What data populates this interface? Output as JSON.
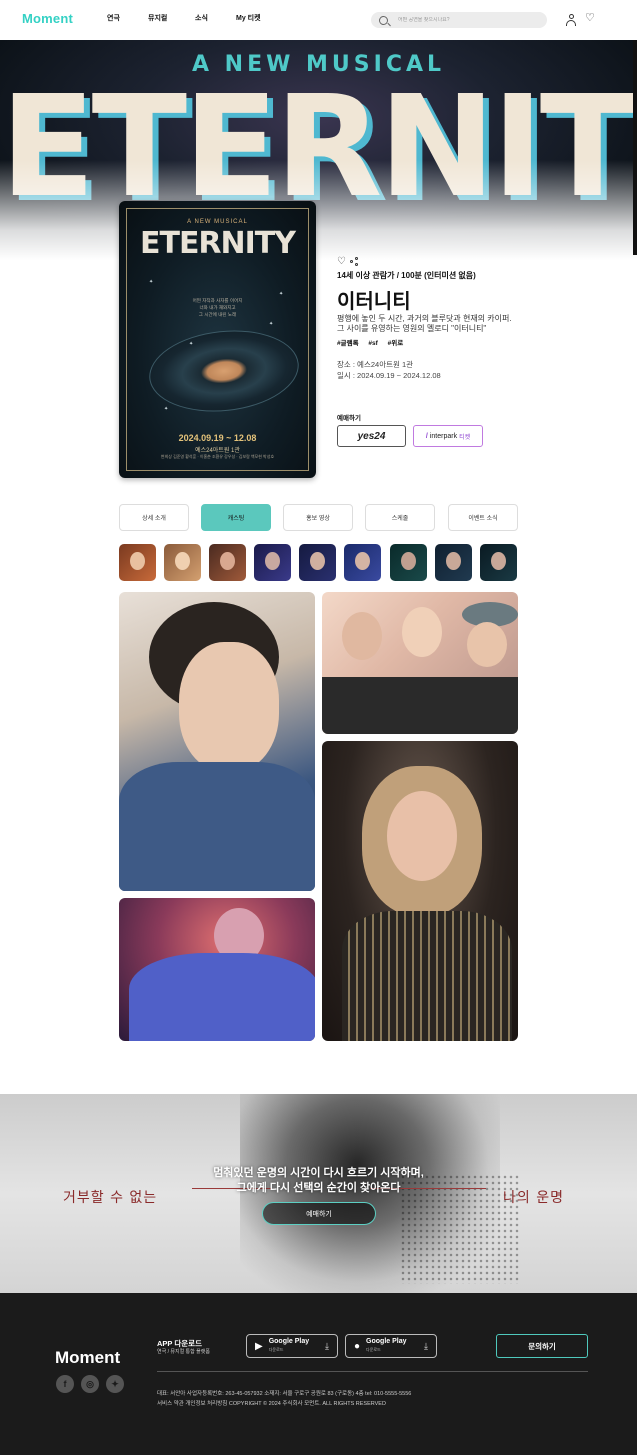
{
  "header": {
    "logo": "Moment",
    "nav": [
      "연극",
      "뮤지컬",
      "소식",
      "My 티켓"
    ],
    "search_placeholder": "어떤 공연을 찾으시나요?"
  },
  "hero": {
    "subtitle": "A NEW MUSICAL",
    "title": "ETERNITY"
  },
  "poster": {
    "subtitle": "A NEW MUSICAL",
    "title": "ETERNITY",
    "text_lines": [
      "어쩐 자작과 사자를 이어지",
      "너와 내가 재와지고",
      "그 시간에 내린 노래"
    ],
    "dates": "2024.09.19 ~ 12.08",
    "venue": "예스24아트원 1관",
    "cast": "변희상 김준영 황석훈 · 이홍춘 조환유 강우성 · 김보람 백모현 박성호"
  },
  "info": {
    "rating": "14세 이상 관람가 / 100분 (인터미션 없음)",
    "title": "이터니티",
    "desc_lines": [
      "평행에 놓인 두 시간, 과거의 블루닷과 현재의 카이퍼.",
      "그 사이를 유영하는 영원의 멜로디 \"이터니티\""
    ],
    "tags": [
      "#글램록",
      "#sf",
      "#위로"
    ],
    "place": "장소 : 예스24아트원 1관",
    "period": "일시 : 2024.09.19 ~ 2024.12.08",
    "booking_label": "예매하기",
    "yes24_label": "yes24",
    "interpark_label": "interpark",
    "interpark_ticket": "티켓"
  },
  "tabs": [
    {
      "label": "상세 소개",
      "active": false
    },
    {
      "label": "캐스팅",
      "active": true
    },
    {
      "label": "홍보 영상",
      "active": false
    },
    {
      "label": "스케줄",
      "active": false
    },
    {
      "label": "이벤트 소식",
      "active": false
    }
  ],
  "banner": {
    "line1": "멈춰있던 운명의 시간이 다시 흐르기 시작하며,",
    "line2": "그에게 다시 선택의 순간이 찾아온다",
    "left_text": "거부할 수 없는",
    "right_text": "나의 운명",
    "cta": "예매하기"
  },
  "footer": {
    "logo": "Moment",
    "app_title": "APP 다운로드",
    "app_sub": "연극 / 뮤지컬 통합 플랫폼",
    "google_play": "Google Play",
    "app_store": "Google Play",
    "store_sub": "다운로드",
    "inquiry": "문의하기",
    "info_line1": "대표: 서안아 사업자등록번호: 263-45-057932 소재지: 서울 구로구 공원로 83 (구로동) 4층 tel: 010-5555-5556",
    "info_line2": "서비스 약관 개인정보 처리방침 COPYRIGHT © 2024 주식회사 모먼트. ALL RIGHTS RESERVED"
  },
  "colors": {
    "accent": "#5bc8bd",
    "brand": "#34d1c4"
  }
}
